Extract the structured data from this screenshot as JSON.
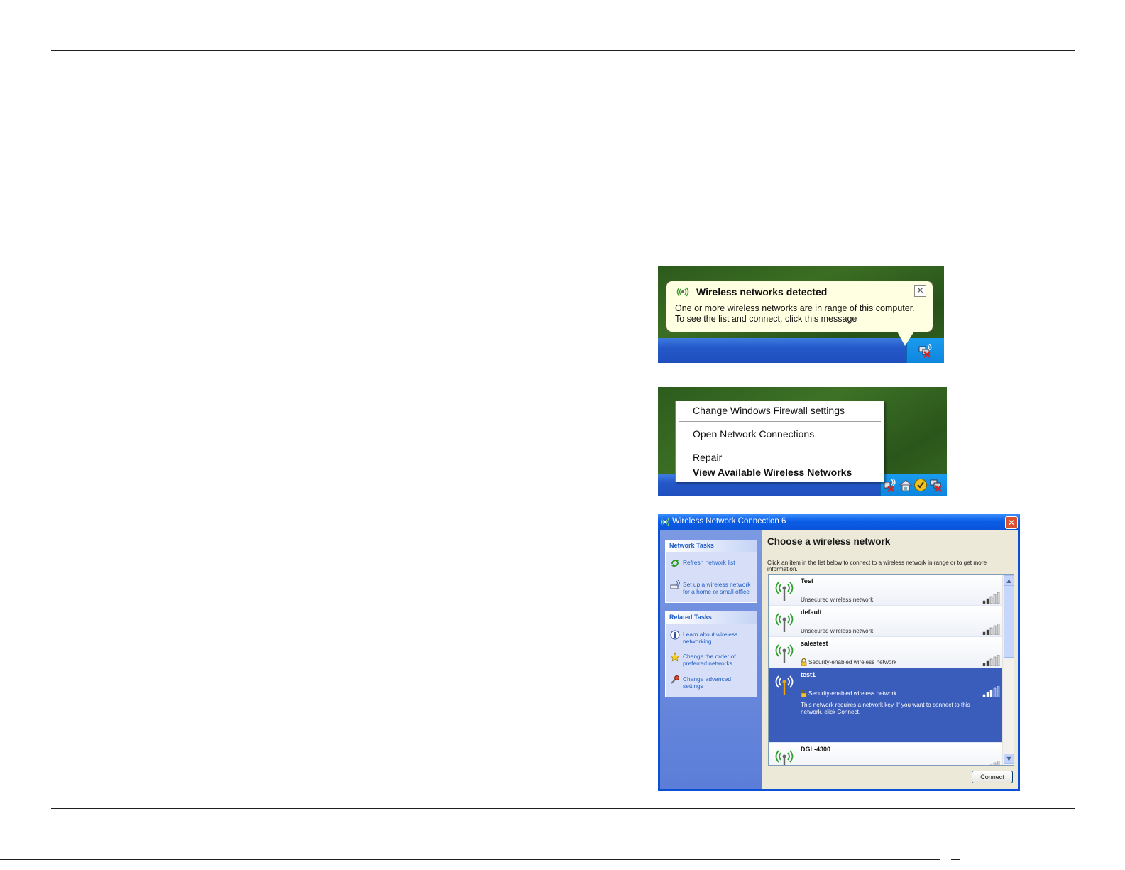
{
  "balloon": {
    "title": "Wireless networks detected",
    "close_glyph": "✕",
    "message_line1": "One or more wireless networks are in range of this computer.",
    "message_line2": "To see the list and connect, click this message",
    "icons": [
      "wireless-icon",
      "network-disconnected-icon"
    ]
  },
  "context_menu": {
    "items": [
      {
        "label": "Change Windows Firewall settings",
        "bold": false
      },
      {
        "label": "Open Network Connections",
        "bold": false
      },
      {
        "label": "Repair",
        "bold": false
      },
      {
        "label": "View Available Wireless Networks",
        "bold": true
      }
    ],
    "tray_icons": [
      "wireless-disconnected-icon",
      "home-network-icon",
      "security-shield-icon",
      "network-disconnected-icon"
    ]
  },
  "dialog": {
    "title": "Wireless Network Connection 6",
    "close_glyph": "✕",
    "heading": "Choose a wireless network",
    "instructions": "Click an item in the list below to connect to a wireless network in range or to get more information.",
    "network_tasks": {
      "header": "Network Tasks",
      "links": [
        {
          "line1": "Refresh network list",
          "line2": "",
          "icon": "refresh-icon"
        },
        {
          "line1": "Set up a wireless network",
          "line2": "for a home or small office",
          "icon": "setup-wireless-icon"
        }
      ]
    },
    "related_tasks": {
      "header": "Related Tasks",
      "links": [
        {
          "line1": "Learn about wireless",
          "line2": "networking",
          "icon": "info-icon"
        },
        {
          "line1": "Change the order of",
          "line2": "preferred networks",
          "icon": "star-icon"
        },
        {
          "line1": "Change advanced",
          "line2": "settings",
          "icon": "settings-icon"
        }
      ]
    },
    "networks": [
      {
        "name": "Test",
        "status": "Unsecured wireless network",
        "secured": false,
        "selected": false,
        "detail": "",
        "signal_level": 0.4
      },
      {
        "name": "default",
        "status": "Unsecured wireless network",
        "secured": false,
        "selected": false,
        "detail": "",
        "signal_level": 0.4
      },
      {
        "name": "salestest",
        "status": "Security-enabled wireless network",
        "secured": true,
        "selected": false,
        "detail": "",
        "signal_level": 0.4
      },
      {
        "name": "test1",
        "status": "Security-enabled wireless network",
        "secured": true,
        "selected": true,
        "detail": "This network requires a network key. If you want to connect to this network, click Connect.",
        "signal_level": 0.6
      },
      {
        "name": "DGL-4300",
        "status": "",
        "secured": false,
        "selected": false,
        "detail": "",
        "signal_level": 0.4
      }
    ],
    "connect_button": "Connect",
    "scroll_up_glyph": "▲",
    "scroll_down_glyph": "▼"
  }
}
